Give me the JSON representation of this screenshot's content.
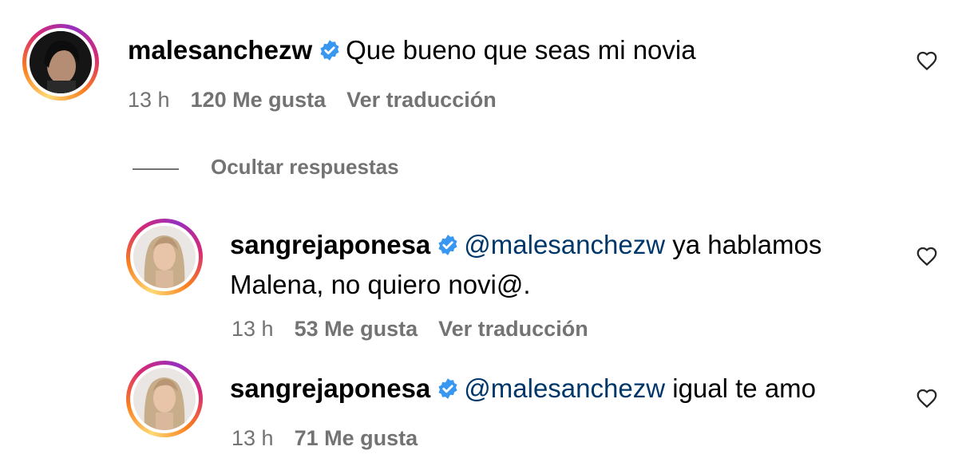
{
  "comments": [
    {
      "username": "malesanchezw",
      "mention": "",
      "text_line1": "Que bueno que seas mi novia",
      "text_line2": "",
      "time": "13 h",
      "likes": "120 Me gusta",
      "translate": "Ver traducción",
      "avatar_icon": "profile-photo-dark-hair",
      "verified_icon": "verified-badge-icon"
    },
    {
      "username": "sangrejaponesa",
      "mention": "@malesanchezw",
      "text_line1": "ya hablamos",
      "text_line2": "Malena, no quiero novi@.",
      "time": "13 h",
      "likes": "53 Me gusta",
      "translate": "Ver traducción",
      "avatar_icon": "profile-photo-blonde",
      "verified_icon": "verified-badge-icon"
    },
    {
      "username": "sangrejaponesa",
      "mention": "@malesanchezw",
      "text_line1": "igual te amo",
      "text_line2": "",
      "time": "13 h",
      "likes": "71 Me gusta",
      "translate": "",
      "avatar_icon": "profile-photo-blonde",
      "verified_icon": "verified-badge-icon"
    }
  ],
  "replies_toggle": "Ocultar respuestas",
  "colors": {
    "verified": "#3897f0",
    "mention": "#00376b",
    "meta": "#737373"
  }
}
